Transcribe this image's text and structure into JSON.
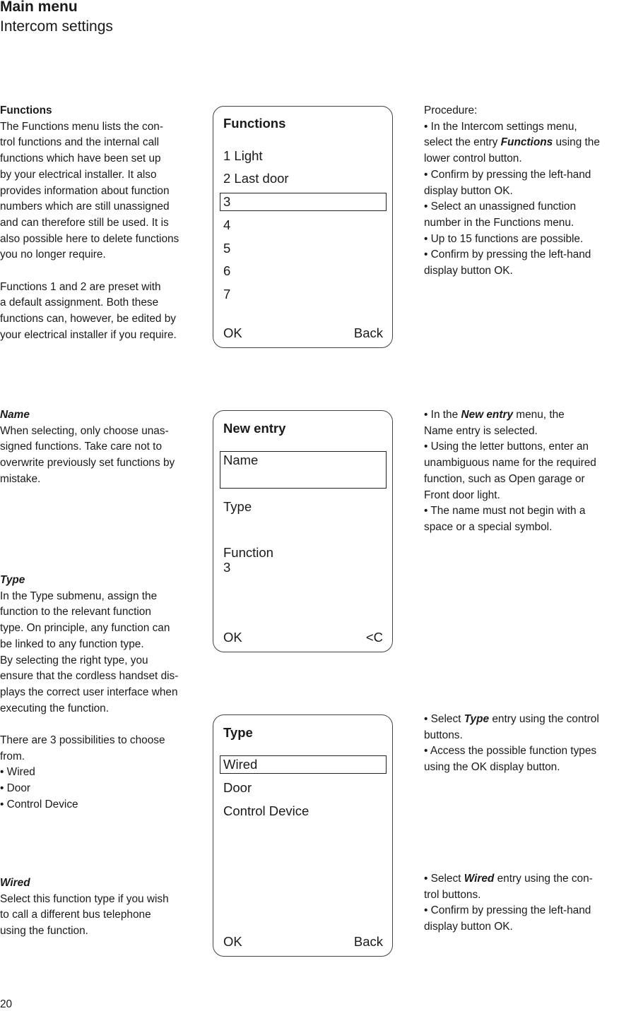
{
  "header": {
    "title": "Main menu",
    "subtitle": "Intercom settings"
  },
  "sections": {
    "functions": {
      "heading": "Functions",
      "para1_lines": [
        "The Functions menu lists the con-",
        "trol functions and the internal call",
        "functions which have been set up",
        "by your electrical installer. It also",
        "provides information about function",
        "numbers which are still unassigned",
        "and can therefore still be used. It is",
        "also possible here to delete functions",
        "you no longer require."
      ],
      "para2_lines": [
        "Functions 1 and 2 are preset with",
        "a default assignment. Both these",
        "functions can, however, be edited by",
        "your electrical installer if you require."
      ]
    },
    "name": {
      "heading": "Name",
      "lines": [
        "When selecting, only choose unas-",
        "signed functions. Take care not to",
        "overwrite previously set functions by",
        "mistake."
      ]
    },
    "type": {
      "heading": "Type",
      "para1_lines": [
        "In the Type submenu, assign the",
        "function to the relevant function",
        "type. On principle, any function can",
        "be linked to any function type.",
        "By selecting the right type, you",
        "ensure that the cordless handset dis-",
        "plays the correct user interface when",
        "executing the function."
      ],
      "para2_lines": [
        "There are 3 possibilities to choose",
        "from."
      ],
      "options": [
        "• Wired",
        "• Door",
        "• Control Device"
      ]
    },
    "wired": {
      "heading": "Wired",
      "lines": [
        "Select this function type if you wish",
        "to call a different bus telephone",
        "using the function."
      ]
    }
  },
  "procedures": {
    "functions": {
      "intro": "Procedure:",
      "l1": "• In the Intercom settings menu,",
      "l2_pre": "select the entry ",
      "l2_em": "Functions",
      "l2_post": " using the",
      "l3": "lower control button.",
      "l4": "• Confirm by pressing the left-hand",
      "l5": "display button OK.",
      "l6": "• Select an unassigned function",
      "l7": "number in the Functions menu.",
      "l8": "• Up to 15 functions are possible.",
      "l9": "• Confirm by pressing the left-hand",
      "l10": "display button OK."
    },
    "name": {
      "l1_pre": "• In the ",
      "l1_em": "New entry",
      "l1_post": " menu, the",
      "l2": "Name entry is selected.",
      "l3": "• Using the letter buttons, enter an",
      "l4": "unambiguous name for the required",
      "l5": "function, such as Open garage or",
      "l6": "Front door light.",
      "l7": "• The name must not begin with a",
      "l8": "space or a special symbol."
    },
    "type": {
      "l1_pre": "• Select ",
      "l1_em": "Type",
      "l1_post": " entry using the control",
      "l2": "buttons.",
      "l3": "• Access the possible function types",
      "l4": "using the OK display button."
    },
    "wired": {
      "l1_pre": "• Select ",
      "l1_em": "Wired",
      "l1_post": " entry using the con-",
      "l2": "trol buttons.",
      "l3": "• Confirm by pressing the left-hand",
      "l4": "display button OK."
    }
  },
  "screens": {
    "functions": {
      "title": "Functions",
      "items": [
        "1 Light",
        "2 Last door",
        "3",
        "4",
        "5",
        "6",
        "7"
      ],
      "selected_index": 2,
      "softkey_left": "OK",
      "softkey_right": "Back"
    },
    "new_entry": {
      "title": "New entry",
      "name_label": "Name",
      "type_label": "Type",
      "function_label": "Function",
      "function_value": "3",
      "softkey_left": "OK",
      "softkey_right": "<C"
    },
    "type": {
      "title": "Type",
      "items": [
        "Wired",
        "Door",
        "Control Device"
      ],
      "selected_index": 0,
      "softkey_left": "OK",
      "softkey_right": "Back"
    }
  },
  "page_number": "20"
}
